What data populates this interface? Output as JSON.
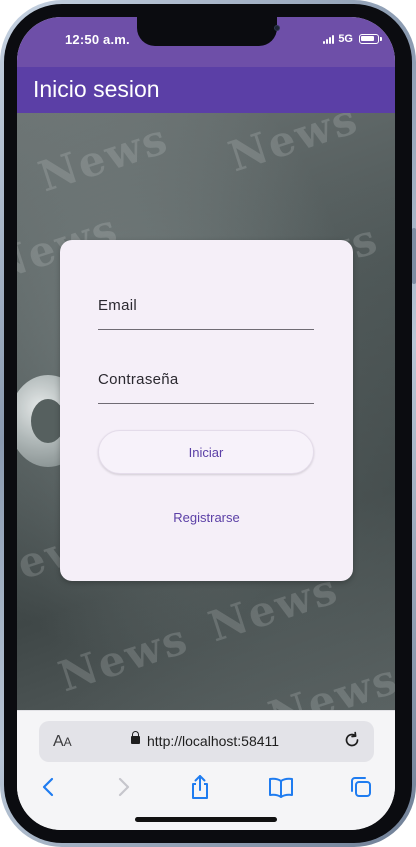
{
  "status_bar": {
    "time": "12:50 a.m.",
    "network": "5G",
    "battery_level": 0.85
  },
  "app_bar": {
    "title": "Inicio sesion"
  },
  "login_card": {
    "email_label": "Email",
    "email_value": "",
    "password_label": "Contraseña",
    "password_value": "",
    "submit_label": "Iniciar",
    "register_label": "Registrarse"
  },
  "background": {
    "words": [
      "News",
      "News",
      "News",
      "News",
      "News",
      "News",
      "News",
      "News"
    ]
  },
  "browser": {
    "text_size_label": "AA",
    "url": "http://localhost:58411",
    "icons": [
      "back-icon",
      "forward-icon",
      "share-icon",
      "bookmarks-icon",
      "tabs-icon",
      "reload-icon",
      "lock-icon"
    ]
  },
  "colors": {
    "primary": "#5b3fa6",
    "status_bar": "#6e4fa8",
    "card_bg": "#f5eff8",
    "ios_blue": "#1f7cf0"
  }
}
